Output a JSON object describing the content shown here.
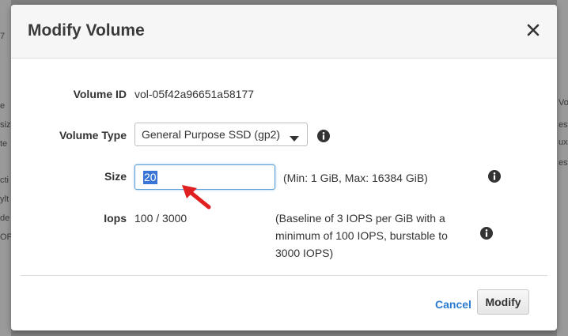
{
  "background": {
    "left_fragments": [
      "7",
      "e",
      "siz",
      "te",
      "cti",
      "ylt",
      "de",
      "OP"
    ],
    "right_fragments": [
      "Vo",
      "es",
      "ux",
      "es"
    ]
  },
  "modal": {
    "title": "Modify Volume",
    "close_icon": "close-icon"
  },
  "form": {
    "volume_id": {
      "label": "Volume ID",
      "value": "vol-05f42a96651a58177"
    },
    "volume_type": {
      "label": "Volume Type",
      "selected": "General Purpose SSD (gp2)",
      "icon": "info-icon"
    },
    "size": {
      "label": "Size",
      "value": "20",
      "hint": "(Min: 1 GiB, Max: 16384 GiB)",
      "icon": "info-icon"
    },
    "iops": {
      "label": "Iops",
      "value": "100 / 3000",
      "hint_lines": [
        "(Baseline of 3 IOPS per GiB with a",
        "minimum of 100 IOPS, burstable to",
        "3000 IOPS)"
      ],
      "icon": "info-icon"
    }
  },
  "footer": {
    "cancel_label": "Cancel",
    "modify_label": "Modify"
  },
  "colors": {
    "link": "#2b7bd1",
    "selection": "#3875d7",
    "annotation_arrow": "#e02020"
  }
}
